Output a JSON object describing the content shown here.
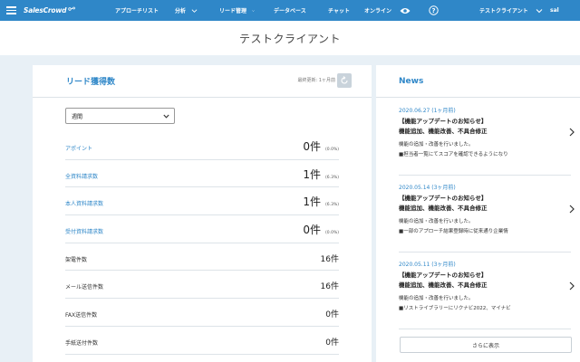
{
  "nav": {
    "logo_text": "SalesCrowd",
    "items": [
      {
        "label": "アプローチリスト"
      },
      {
        "label": "分析"
      },
      {
        "label": "リード管理"
      },
      {
        "label": "データベース"
      },
      {
        "label": "チャット"
      },
      {
        "label": "オンライン"
      }
    ],
    "client_label": "テストクライアント",
    "user_label": "sal",
    "colors": {
      "bar": "#2f87c8",
      "accent": "#2f87c8"
    },
    "icons": [
      "menu-icon",
      "eye-icon",
      "help-icon",
      "chevron-down-icon"
    ]
  },
  "page": {
    "title": "テストクライアント"
  },
  "leads": {
    "title": "リード獲得数",
    "updated": "最終更新: 1ヶ月前",
    "period_selected": "週間",
    "rows": [
      {
        "label": "アポイント",
        "link": true,
        "value": "0件",
        "pct": "(0.0%)"
      },
      {
        "label": "全資料請求数",
        "link": true,
        "value": "1件",
        "pct": "(6.3%)"
      },
      {
        "label": "本人資料請求数",
        "link": true,
        "value": "1件",
        "pct": "(6.3%)"
      },
      {
        "label": "受付資料請求数",
        "link": true,
        "value": "0件",
        "pct": "(0.0%)"
      },
      {
        "label": "架電件数",
        "link": false,
        "value": "16件",
        "pct": ""
      },
      {
        "label": "メール送信件数",
        "link": false,
        "value": "16件",
        "pct": ""
      },
      {
        "label": "FAX送信件数",
        "link": false,
        "value": "0件",
        "pct": ""
      },
      {
        "label": "手紙送付件数",
        "link": false,
        "value": "0件",
        "pct": ""
      }
    ]
  },
  "news": {
    "title": "News",
    "items": [
      {
        "date": "2020.06.27 (1ヶ月前)",
        "title1": "【機能アップデートのお知らせ】",
        "title2": "機能追加、機能改善、不具合修正",
        "body1": "機能の追加・改善を行いました。",
        "body2": "■担当者一覧にてスコアを確認できるようになり"
      },
      {
        "date": "2020.05.14 (3ヶ月前)",
        "title1": "【機能アップデートのお知らせ】",
        "title2": "機能追加、機能改善、不具合修正",
        "body1": "機能の追加・改善を行いました。",
        "body2": "■一部のアプローチ結果登録時に従来通り企業情"
      },
      {
        "date": "2020.05.11 (3ヶ月前)",
        "title1": "【機能アップデートのお知らせ】",
        "title2": "機能追加、機能改善、不具合修正",
        "body1": "機能の追加・改善を行いました。",
        "body2": "■リストライブラリーにリクナビ2022、マイナビ"
      }
    ],
    "more_label": "さらに表示"
  }
}
